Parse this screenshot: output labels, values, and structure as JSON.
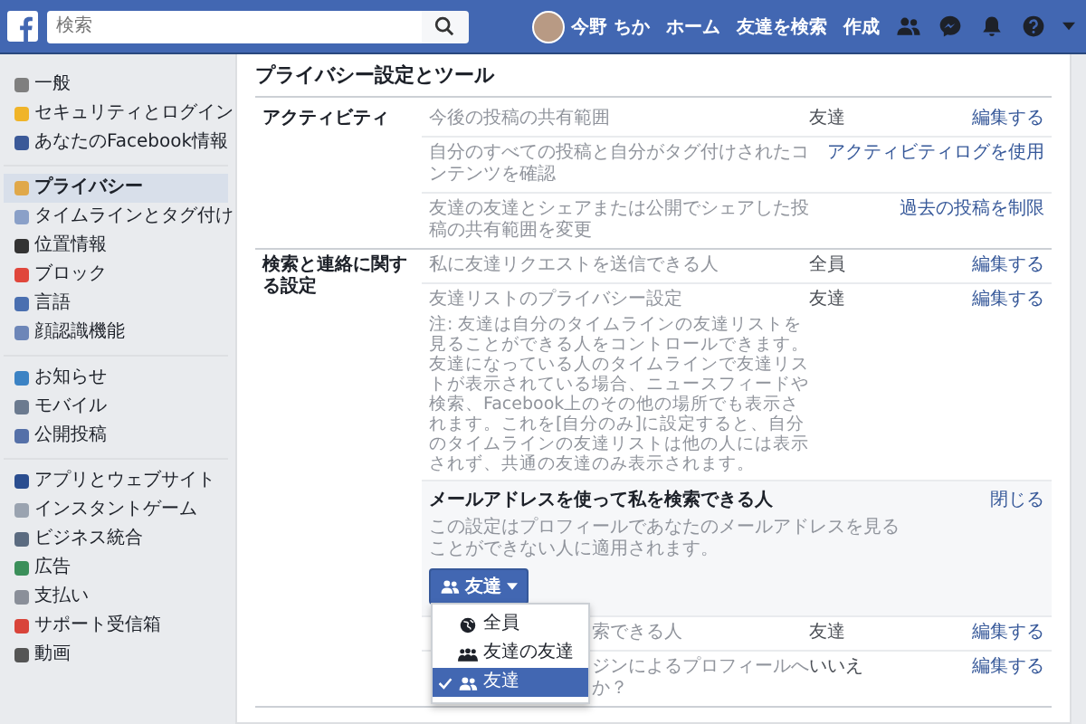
{
  "top_bar": {
    "search": {
      "placeholder": "検索"
    },
    "user_name": "今野 ちか",
    "nav": [
      "ホーム",
      "友達を検索",
      "作成"
    ]
  },
  "sidebar": {
    "groups": [
      {
        "items": [
          {
            "label": "一般",
            "selected": false
          },
          {
            "label": "セキュリティとログイン",
            "selected": false
          },
          {
            "label": "あなたのFacebook情報",
            "selected": false
          }
        ]
      },
      {
        "items": [
          {
            "label": "プライバシー",
            "selected": true
          },
          {
            "label": "タイムラインとタグ付け",
            "selected": false
          },
          {
            "label": "位置情報",
            "selected": false
          },
          {
            "label": "ブロック",
            "selected": false
          },
          {
            "label": "言語",
            "selected": false
          },
          {
            "label": "顔認識機能",
            "selected": false
          }
        ]
      },
      {
        "items": [
          {
            "label": "お知らせ",
            "selected": false
          },
          {
            "label": "モバイル",
            "selected": false
          },
          {
            "label": "公開投稿",
            "selected": false
          }
        ]
      },
      {
        "items": [
          {
            "label": "アプリとウェブサイト",
            "selected": false
          },
          {
            "label": "インスタントゲーム",
            "selected": false
          },
          {
            "label": "ビジネス統合",
            "selected": false
          },
          {
            "label": "広告",
            "selected": false
          },
          {
            "label": "支払い",
            "selected": false
          },
          {
            "label": "サポート受信箱",
            "selected": false
          },
          {
            "label": "動画",
            "selected": false
          }
        ]
      }
    ]
  },
  "main": {
    "title": "プライバシー設定とツール",
    "sections": [
      {
        "title": "アクティビティ",
        "rows": [
          {
            "kind": "setting",
            "label": "今後の投稿の共有範囲",
            "value": "友達",
            "action": "編集する"
          },
          {
            "kind": "setting",
            "label": "自分のすべての投稿と自分がタグ付けされたコンテンツを確認",
            "action": "アクティビティログを使用"
          },
          {
            "kind": "setting",
            "label": "友達の友達とシェアまたは公開でシェアした投稿の共有範囲を変更",
            "action": "過去の投稿を制限"
          }
        ]
      },
      {
        "title": "検索と連絡に関する設定",
        "rows": [
          {
            "kind": "setting",
            "label": "私に友達リクエストを送信できる人",
            "value": "全員",
            "action": "編集する"
          },
          {
            "kind": "setting",
            "label": "友達リストのプライバシー設定",
            "note": "注: 友達は自分のタイムラインの友達リストを見ることができる人をコントロールできます。友達になっている人のタイムラインで友達リストが表示されている場合、ニュースフィードや検索、Facebook上のその他の場所でも表示されます。これを[自分のみ]に設定すると、自分のタイムラインの友達リストは他の人には表示されず、共通の友達のみ表示されます。",
            "value": "友達",
            "action": "編集する"
          },
          {
            "kind": "expanded",
            "label": "メールアドレスを使って私を検索できる人",
            "note": "この設定はプロフィールであなたのメールアドレスを見ることができない人に適用されます。",
            "action": "閉じる",
            "dropdown": {
              "label": "友達",
              "open": true,
              "options": [
                {
                  "kind": "public",
                  "label": "全員",
                  "selected": false
                },
                {
                  "kind": "friends_of_friends",
                  "label": "友達の友達",
                  "selected": false
                },
                {
                  "kind": "friends",
                  "label": "友達",
                  "selected": true
                }
              ]
            }
          },
          {
            "kind": "covered",
            "label": "索できる人",
            "value": "友達",
            "action": "編集する"
          },
          {
            "kind": "covered",
            "label": "ジンによるプロフィールへか？",
            "value": "いいえ",
            "action": "編集する"
          }
        ]
      }
    ]
  }
}
